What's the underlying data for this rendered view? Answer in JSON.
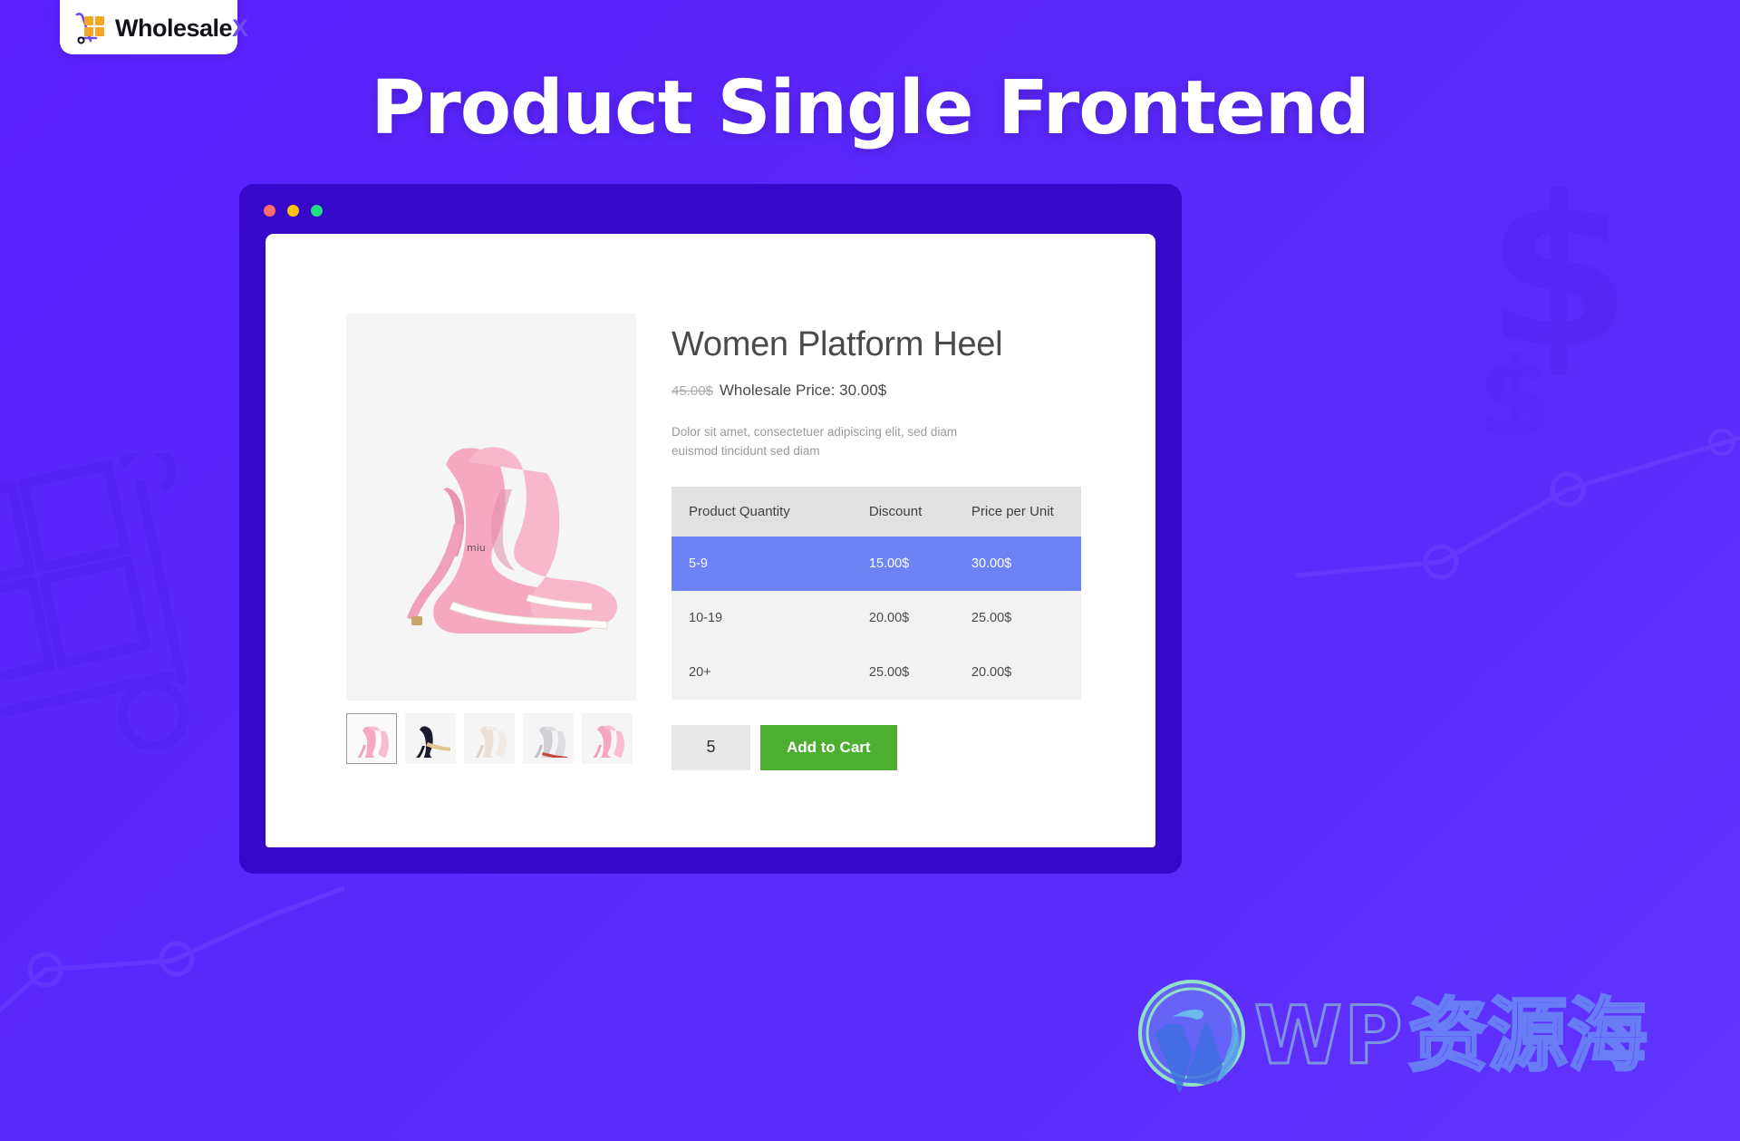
{
  "brand": {
    "logo_text": "Wholesale",
    "logo_accent": "X",
    "logo_icon": "trolley-boxes-icon"
  },
  "headline": "Product Single Frontend",
  "browser": {
    "dots": [
      "close-dot",
      "minimize-dot",
      "maximize-dot"
    ],
    "dot_colors": [
      "#ff6b6b",
      "#ffc107",
      "#20dd7f"
    ]
  },
  "product": {
    "title": "Women Platform Heel",
    "price_old": "45.00$",
    "price_new": "Wholesale Price: 30.00$",
    "description": "Dolor sit amet, consectetuer adipiscing elit, sed diam euismod tincidunt sed diam",
    "gallery": {
      "main_alt": "pink-platform-heels",
      "thumbnails": [
        {
          "name": "thumb-pink-heels",
          "active": true
        },
        {
          "name": "thumb-black-heels",
          "active": false
        },
        {
          "name": "thumb-nude-heels",
          "active": false
        },
        {
          "name": "thumb-glitter-heels",
          "active": false
        },
        {
          "name": "thumb-pink-heels-alt",
          "active": false
        }
      ]
    },
    "quantity_value": "5",
    "add_to_cart_label": "Add to Cart"
  },
  "tier_table": {
    "headers": [
      "Product Quantity",
      "Discount",
      "Price per Unit"
    ],
    "rows": [
      {
        "quantity": "5-9",
        "discount": "15.00$",
        "price_per_unit": "30.00$",
        "highlight": true
      },
      {
        "quantity": "10-19",
        "discount": "20.00$",
        "price_per_unit": "25.00$",
        "highlight": false
      },
      {
        "quantity": "20+",
        "discount": "25.00$",
        "price_per_unit": "20.00$",
        "highlight": false
      }
    ]
  },
  "watermark": {
    "logo": "wordpress-icon",
    "text_latin": "WP",
    "text_cjk": "资源海"
  },
  "colors": {
    "background_start": "#5a20ff",
    "background_end": "#6034ff",
    "browser_frame": "#3708c9",
    "highlight_row": "#6b83f5",
    "add_to_cart": "#4caf2f",
    "table_header": "#e1e1e1",
    "table_body": "#f2f2f2",
    "logo_accent": "#6c4bf4"
  }
}
